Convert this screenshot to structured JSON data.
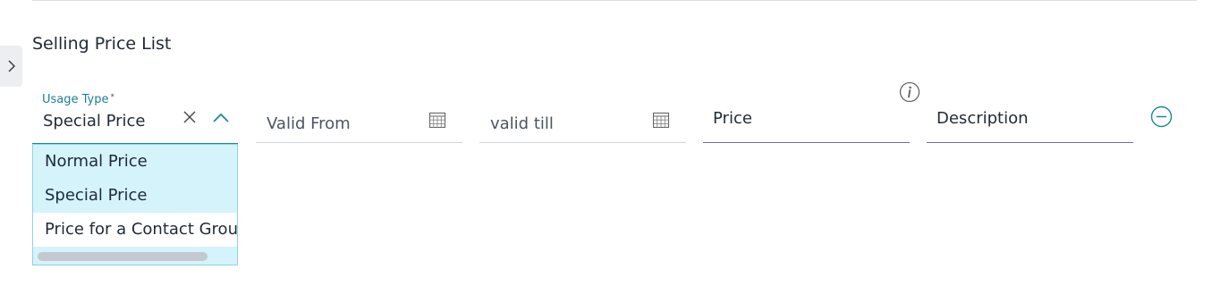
{
  "section": {
    "title": "Selling Price List"
  },
  "usage_type": {
    "label": "Usage Type",
    "required_mark": "*",
    "value": "Special Price",
    "options": [
      "Normal Price",
      "Special Price",
      "Price for a Contact Group"
    ]
  },
  "valid_from": {
    "placeholder": "Valid From"
  },
  "valid_till": {
    "placeholder": "valid till"
  },
  "price": {
    "label": "Price"
  },
  "description": {
    "label": "Description"
  },
  "colors": {
    "accent": "#1a8a9e",
    "dropdown_bg": "#d5f3fb",
    "dropdown_border": "#8fd3e3"
  },
  "icons": {
    "sidebar": "chevron-right-icon",
    "clear": "close-icon",
    "collapse": "chevron-up-icon",
    "calendar": "calendar-icon",
    "info": "info-icon",
    "remove": "minus-circle-icon"
  }
}
